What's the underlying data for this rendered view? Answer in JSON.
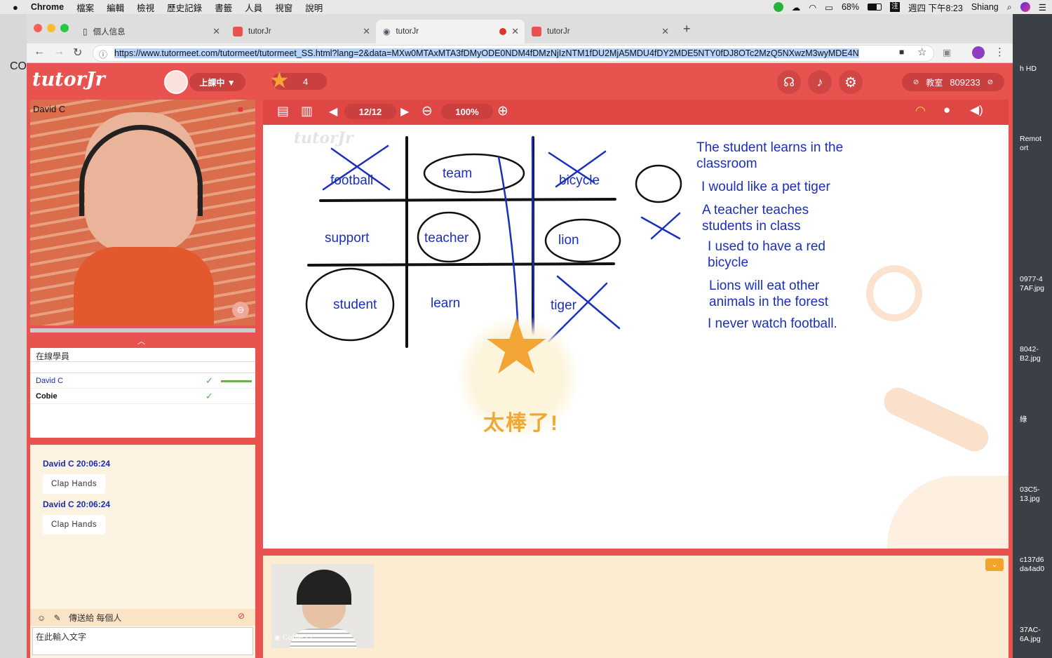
{
  "menubar": {
    "app": "Chrome",
    "items": [
      "檔案",
      "編輯",
      "檢視",
      "歷史記錄",
      "書籤",
      "人員",
      "視窗",
      "說明"
    ],
    "battery": "68%",
    "datetime": "週四 下午8:23",
    "user": "Shiang"
  },
  "desktop": {
    "labels": [
      "h HD",
      "Remot\nort",
      "0977-4\n7AF.jpg",
      "8042-\nB2.jpg",
      "綠",
      "03C5-\n13.jpg",
      "c137d6\nda4ad0",
      "37AC-\n6A.jpg"
    ],
    "left_label": "CO"
  },
  "tabs": [
    {
      "title": "個人信息"
    },
    {
      "title": "tutorJr"
    },
    {
      "title": "tutorJr"
    },
    {
      "title": "tutorJr"
    }
  ],
  "url": "https://www.tutormeet.com/tutormeet/tutormeet_SS.html?lang=2&data=MXw0MTAxMTA3fDMyODE0NDM4fDMzNjIzNTM1fDU2MjA5MDU4fDY2MDE5NTY0fDJ8OTc2MzQ5NXwzM3wyMDE4N",
  "app": {
    "logo": "tutorJr",
    "status": "上課中 ▼",
    "stars": "4",
    "room_label": "教室",
    "room_number": "809233",
    "page": "12/12",
    "zoom": "100%"
  },
  "video": {
    "teacher_name": "David C",
    "student_name": "Cobie Li"
  },
  "online": {
    "title": "在線學員",
    "users": [
      {
        "name": "David C"
      },
      {
        "name": "Cobie"
      }
    ]
  },
  "chat": {
    "messages": [
      {
        "from": "David C 20:06:24",
        "text": "Clap Hands"
      },
      {
        "from": "David C 20:06:24",
        "text": "Clap Hands"
      }
    ],
    "send_to": "傳送給 每個人",
    "placeholder": "在此輸入文字"
  },
  "board": {
    "watermark": "tutorJr",
    "grid": [
      "football",
      "team",
      "bicycle",
      "support",
      "teacher",
      "lion",
      "student",
      "learn",
      "tiger"
    ],
    "sentences": [
      "The student learns in the\nclassroom",
      "I would like a pet tiger",
      "A teacher teaches\nstudents in class",
      "I used to have a red\nbicycle",
      "Lions will eat other\nanimals in the forest",
      "I never watch football."
    ],
    "praise": "太棒了!"
  },
  "colors": {
    "brand": "#e8524f",
    "ink": "#1a2fbf",
    "star": "#f2a534"
  }
}
